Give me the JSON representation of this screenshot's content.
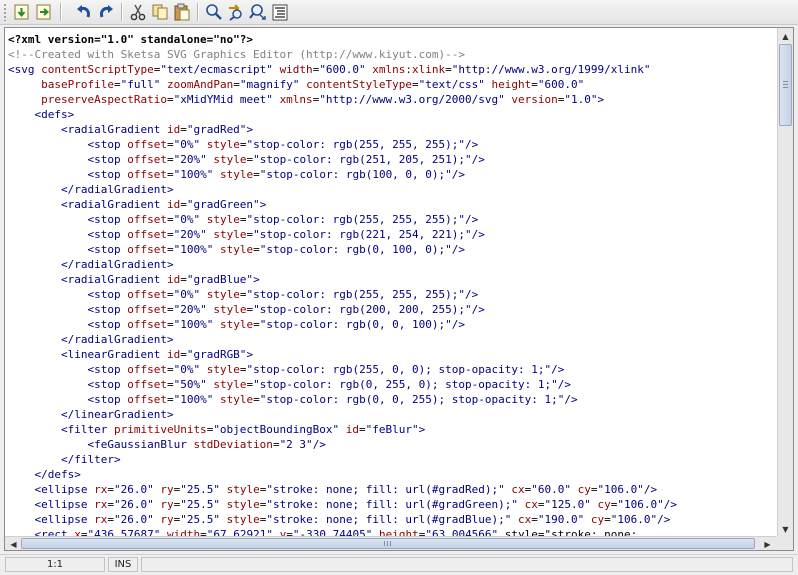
{
  "toolbar": {
    "buttons": [
      {
        "name": "move-down-icon"
      },
      {
        "name": "move-right-icon"
      },
      {
        "name": "undo-icon"
      },
      {
        "name": "redo-icon"
      },
      {
        "name": "cut-icon"
      },
      {
        "name": "copy-icon"
      },
      {
        "name": "paste-icon"
      },
      {
        "name": "find-icon"
      },
      {
        "name": "find-replace-icon"
      },
      {
        "name": "find-next-icon"
      },
      {
        "name": "format-icon"
      }
    ]
  },
  "colors": {
    "tag": "#000080",
    "attribute": "#8a0000",
    "value": "#000080",
    "comment": "#808080"
  },
  "editor": {
    "lines": [
      "<?xml version=\"1.0\" standalone=\"no\"?>",
      "<!--Created with Sketsa SVG Graphics Editor (http://www.kiyut.com)-->",
      "<svg contentScriptType=\"text/ecmascript\" width=\"600.0\" xmlns:xlink=\"http://www.w3.org/1999/xlink\"",
      "     baseProfile=\"full\" zoomAndPan=\"magnify\" contentStyleType=\"text/css\" height=\"600.0\"",
      "     preserveAspectRatio=\"xMidYMid meet\" xmlns=\"http://www.w3.org/2000/svg\" version=\"1.0\">",
      "    <defs>",
      "        <radialGradient id=\"gradRed\">",
      "            <stop offset=\"0%\" style=\"stop-color: rgb(255, 255, 255);\"/>",
      "            <stop offset=\"20%\" style=\"stop-color: rgb(251, 205, 251);\"/>",
      "            <stop offset=\"100%\" style=\"stop-color: rgb(100, 0, 0);\"/>",
      "        </radialGradient>",
      "        <radialGradient id=\"gradGreen\">",
      "            <stop offset=\"0%\" style=\"stop-color: rgb(255, 255, 255);\"/>",
      "            <stop offset=\"20%\" style=\"stop-color: rgb(221, 254, 221);\"/>",
      "            <stop offset=\"100%\" style=\"stop-color: rgb(0, 100, 0);\"/>",
      "        </radialGradient>",
      "        <radialGradient id=\"gradBlue\">",
      "            <stop offset=\"0%\" style=\"stop-color: rgb(255, 255, 255);\"/>",
      "            <stop offset=\"20%\" style=\"stop-color: rgb(200, 200, 255);\"/>",
      "            <stop offset=\"100%\" style=\"stop-color: rgb(0, 0, 100);\"/>",
      "        </radialGradient>",
      "        <linearGradient id=\"gradRGB\">",
      "            <stop offset=\"0%\" style=\"stop-color: rgb(255, 0, 0); stop-opacity: 1;\"/>",
      "            <stop offset=\"50%\" style=\"stop-color: rgb(0, 255, 0); stop-opacity: 1;\"/>",
      "            <stop offset=\"100%\" style=\"stop-color: rgb(0, 0, 255); stop-opacity: 1;\"/>",
      "        </linearGradient>",
      "        <filter primitiveUnits=\"objectBoundingBox\" id=\"feBlur\">",
      "            <feGaussianBlur stdDeviation=\"2 3\"/>",
      "        </filter>",
      "    </defs>",
      "    <ellipse rx=\"26.0\" ry=\"25.5\" style=\"stroke: none; fill: url(#gradRed);\" cx=\"60.0\" cy=\"106.0\"/>",
      "    <ellipse rx=\"26.0\" ry=\"25.5\" style=\"stroke: none; fill: url(#gradGreen);\" cx=\"125.0\" cy=\"106.0\"/>",
      "    <ellipse rx=\"26.0\" ry=\"25.5\" style=\"stroke: none; fill: url(#gradBlue);\" cx=\"190.0\" cy=\"106.0\"/>",
      "    <rect x=\"436.57687\" width=\"67.62921\" y=\"-330.74405\" height=\"63.004566\" style=\"stroke: none;"
    ]
  },
  "status": {
    "position": "1:1",
    "mode": "INS"
  }
}
